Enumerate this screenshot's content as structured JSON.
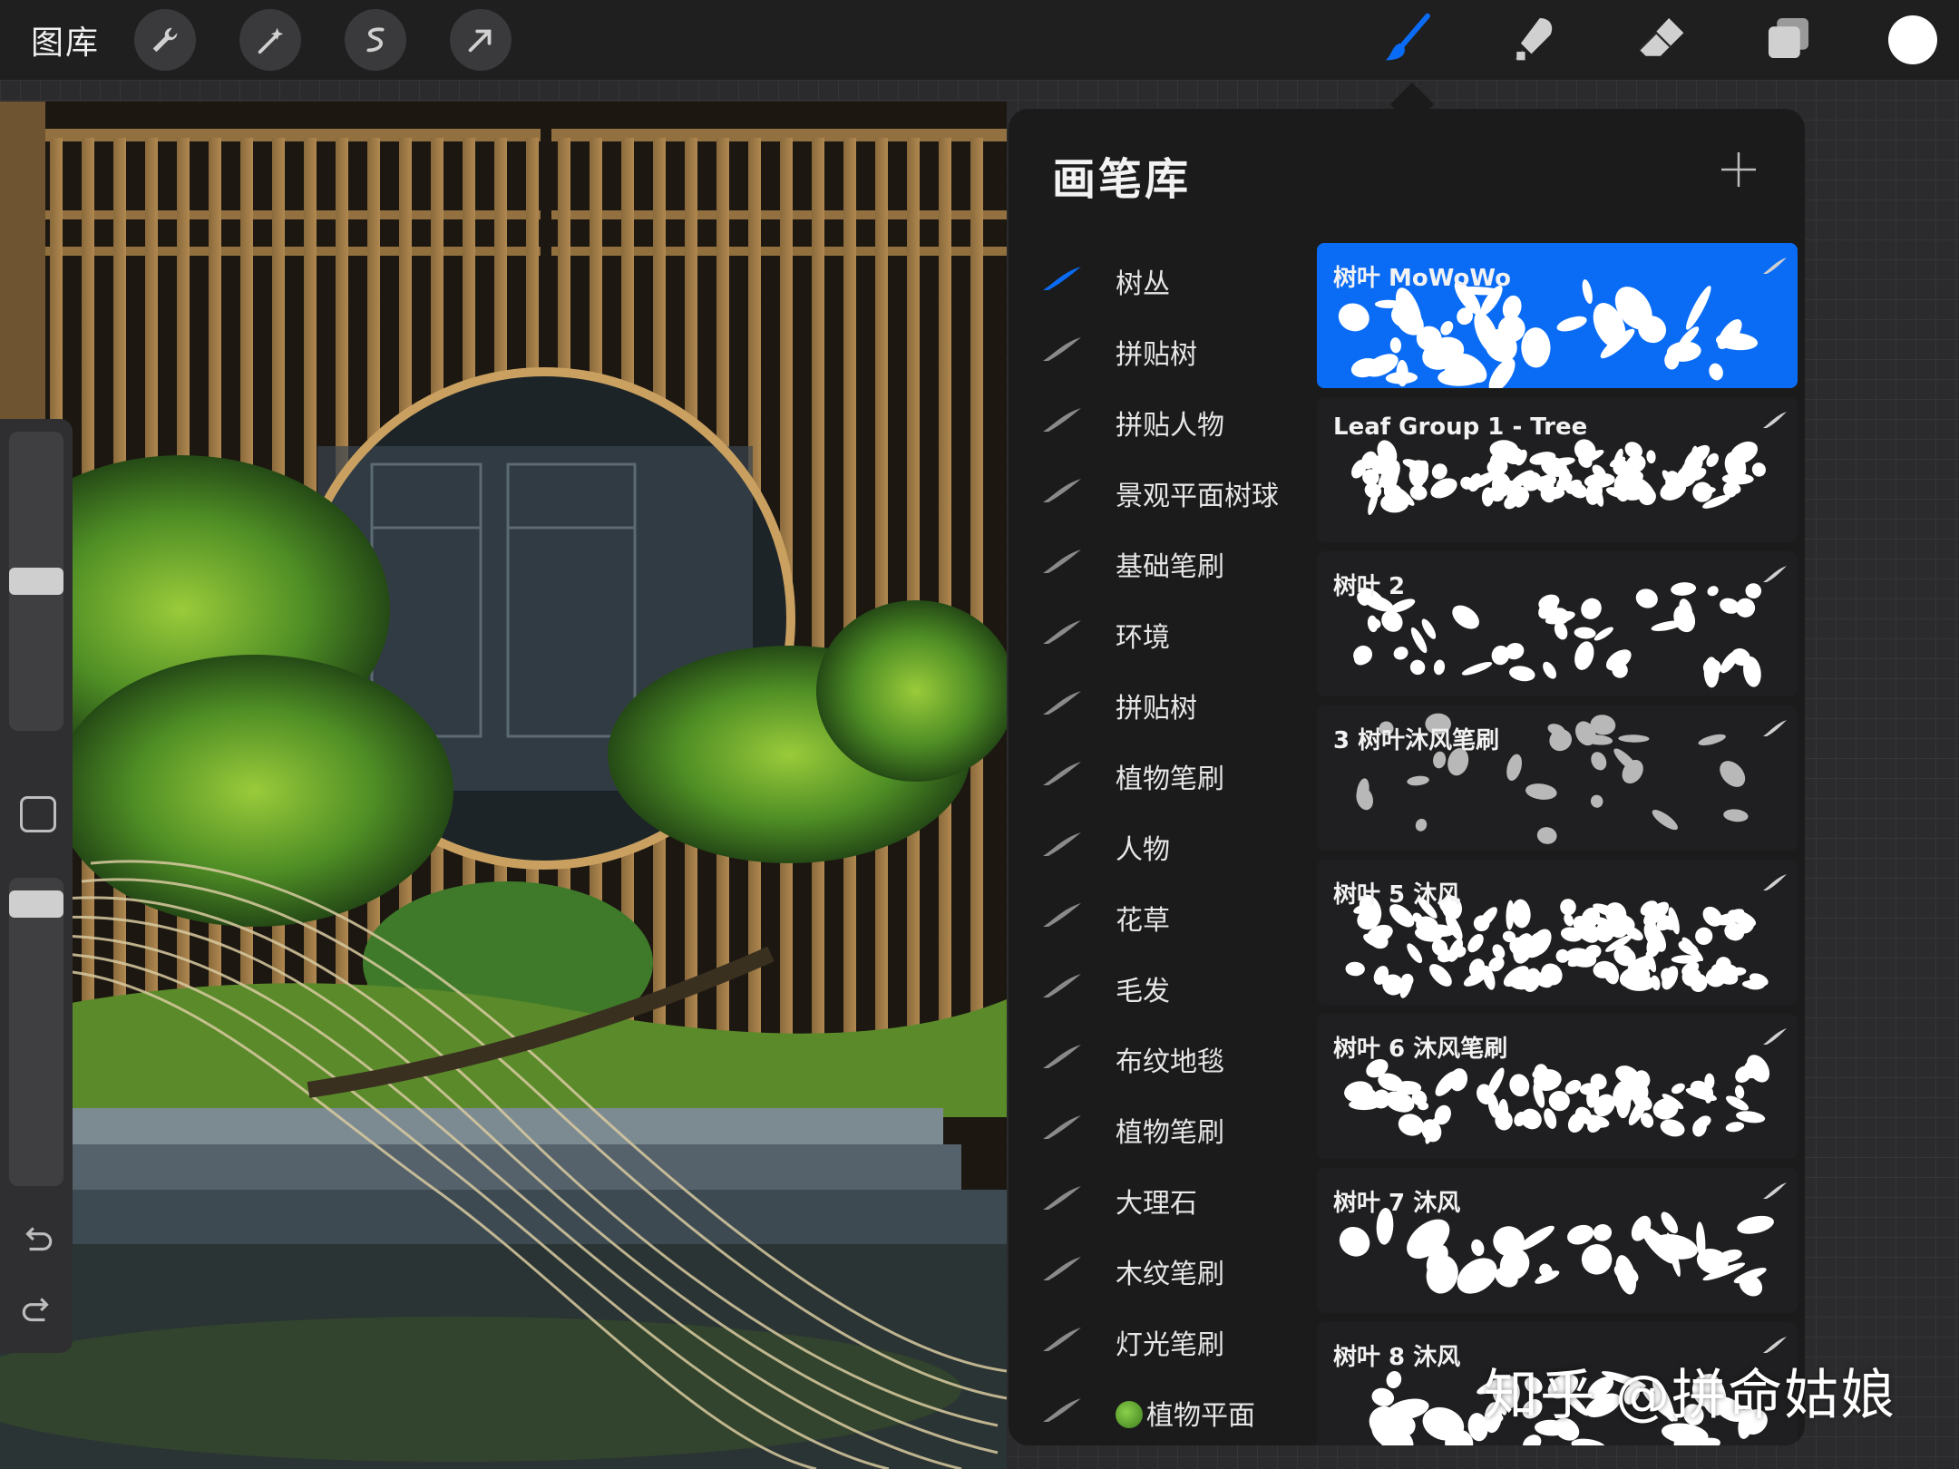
{
  "topbar": {
    "gallery_label": "图库",
    "left_tools": [
      "wrench-icon",
      "magic-wand-icon",
      "selection-icon",
      "transform-arrow-icon"
    ],
    "right_tools": [
      "brush-icon",
      "smudge-icon",
      "eraser-icon",
      "layers-icon"
    ],
    "active_tool": "brush",
    "current_color": "#ffffff",
    "accent_color": "#0a6cf5"
  },
  "panel": {
    "title": "画笔库",
    "add_icon": "plus-icon"
  },
  "brush_sets": [
    {
      "label": "树丛",
      "selected": true
    },
    {
      "label": "拼贴树"
    },
    {
      "label": "拼贴人物"
    },
    {
      "label": "景观平面树球"
    },
    {
      "label": "基础笔刷"
    },
    {
      "label": "环境"
    },
    {
      "label": "拼贴树"
    },
    {
      "label": "植物笔刷"
    },
    {
      "label": "人物"
    },
    {
      "label": "花草"
    },
    {
      "label": "毛发"
    },
    {
      "label": "布纹地毯"
    },
    {
      "label": "植物笔刷"
    },
    {
      "label": "大理石"
    },
    {
      "label": "木纹笔刷"
    },
    {
      "label": "灯光笔刷"
    },
    {
      "label": "植物平面"
    }
  ],
  "brushes": [
    {
      "name": "树叶 MoWoWo",
      "selected": true
    },
    {
      "name": "Leaf Group 1 - Tree"
    },
    {
      "name": "树叶 2"
    },
    {
      "name": "3 树叶沐风笔刷"
    },
    {
      "name": "树叶 5 沐风"
    },
    {
      "name": "树叶 6 沐风笔刷"
    },
    {
      "name": "树叶 7 沐风"
    },
    {
      "name": "树叶 8 沐风"
    }
  ],
  "watermark": "知乎 @拼命姑娘"
}
